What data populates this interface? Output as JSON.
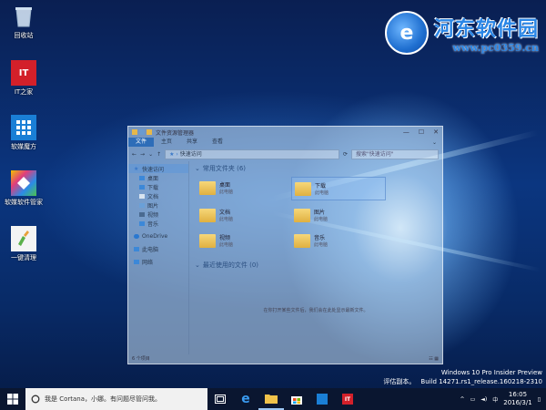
{
  "watermark": {
    "title": "河东软件园",
    "url": "www.pc0359.cn"
  },
  "desktop_icons": [
    {
      "label": "回收站",
      "icon": "recycle-bin-icon"
    },
    {
      "label": "IT之家",
      "icon": "ithome-icon"
    },
    {
      "label": "软媒魔方",
      "icon": "ruanmei-mofang-icon"
    },
    {
      "label": "软媒软件管家",
      "icon": "software-manager-icon"
    },
    {
      "label": "一键清理",
      "icon": "cleanup-icon"
    }
  ],
  "explorer": {
    "title": "文件资源管理器",
    "ribbon_tabs": [
      "文件",
      "主页",
      "共享",
      "查看"
    ],
    "address": "快速访问",
    "search_placeholder": "搜索\"快速访问\"",
    "nav": [
      {
        "label": "快速访问"
      },
      {
        "label": "桌面"
      },
      {
        "label": "下载"
      },
      {
        "label": "文档"
      },
      {
        "label": "图片"
      },
      {
        "label": "视频"
      },
      {
        "label": "音乐"
      },
      {
        "label": "OneDrive"
      },
      {
        "label": "此电脑"
      },
      {
        "label": "网络"
      }
    ],
    "frequent_header": "常用文件夹 (6)",
    "folders": [
      {
        "name": "桌面",
        "location": "此电脑"
      },
      {
        "name": "下载",
        "location": "此电脑"
      },
      {
        "name": "文档",
        "location": "此电脑"
      },
      {
        "name": "图片",
        "location": "此电脑"
      },
      {
        "name": "视频",
        "location": "此电脑"
      },
      {
        "name": "音乐",
        "location": "此电脑"
      }
    ],
    "recent_header": "最近使用的文件 (0)",
    "recent_empty": "在你打开某些文件后，我们会在此处显示最新文件。",
    "status": "6 个项目"
  },
  "version": {
    "line1": "Windows 10 Pro Insider Preview",
    "line2_label": "评估副本。",
    "line2_build": "Build 14271.rs1_release.160218-2310"
  },
  "taskbar": {
    "cortana_placeholder": "我是 Cortana，小娜。有问题尽管问我。",
    "ime": "中",
    "time": "16:05",
    "date": "2016/3/1"
  },
  "colors": {
    "accent": "#2e6db8",
    "taskbar": "#0a1630",
    "watermark": "#2a86e6"
  }
}
